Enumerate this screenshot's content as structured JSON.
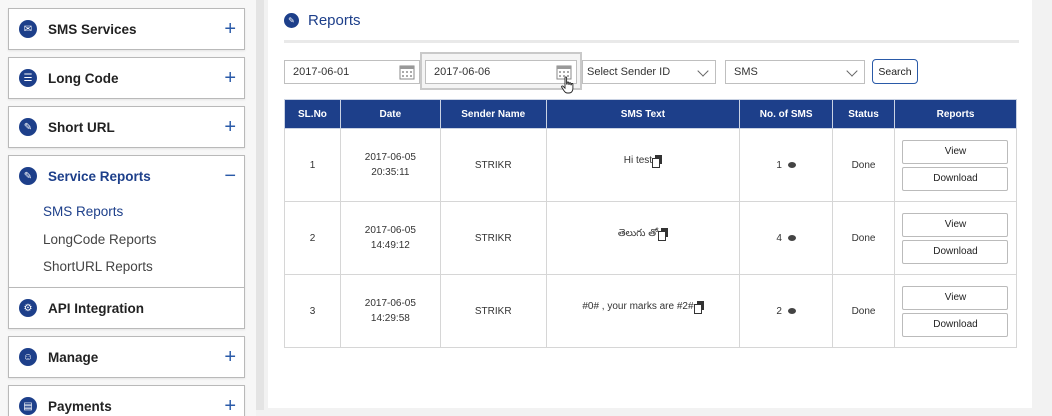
{
  "sidebar": {
    "menus": [
      {
        "label": "SMS Services",
        "toggle": "+",
        "icon": "chat-bubble-icon"
      },
      {
        "label": "Long Code",
        "toggle": "+",
        "icon": "chat-icon"
      },
      {
        "label": "Short URL",
        "toggle": "+",
        "icon": "link-icon"
      },
      {
        "label": "Service Reports",
        "toggle": "−",
        "icon": "report-icon"
      },
      {
        "label": "API Integration",
        "toggle": "",
        "icon": "api-icon"
      },
      {
        "label": "Manage",
        "toggle": "+",
        "icon": "manage-icon"
      },
      {
        "label": "Payments",
        "toggle": "+",
        "icon": "payments-icon"
      }
    ],
    "service_reports_items": [
      "SMS Reports",
      "LongCode Reports",
      "ShortURL Reports"
    ],
    "active_item": "SMS Reports"
  },
  "page": {
    "title": "Reports"
  },
  "filters": {
    "from_date": "2017-06-01",
    "to_date": "2017-06-06",
    "sender_select": "Select Sender ID",
    "type_select": "SMS",
    "search_label": "Search"
  },
  "table": {
    "headers": [
      "SL.No",
      "Date",
      "Sender Name",
      "SMS Text",
      "No. of SMS",
      "Status",
      "Reports"
    ],
    "rows": [
      {
        "sl": "1",
        "date": "2017-06-05",
        "time": "20:35:11",
        "sender": "STRIKR",
        "text": "Hi test",
        "count": "1",
        "status": "Done",
        "view": "View",
        "download": "Download"
      },
      {
        "sl": "2",
        "date": "2017-06-05",
        "time": "14:49:12",
        "sender": "STRIKR",
        "text": "తెలుగు తో",
        "count": "4",
        "status": "Done",
        "view": "View",
        "download": "Download"
      },
      {
        "sl": "3",
        "date": "2017-06-05",
        "time": "14:29:58",
        "sender": "STRIKR",
        "text": "#0# , your marks are #2#",
        "count": "2",
        "status": "Done",
        "view": "View",
        "download": "Download"
      }
    ]
  },
  "colors": {
    "brand": "#1d3f8a",
    "accent": "#2a5aa8"
  }
}
